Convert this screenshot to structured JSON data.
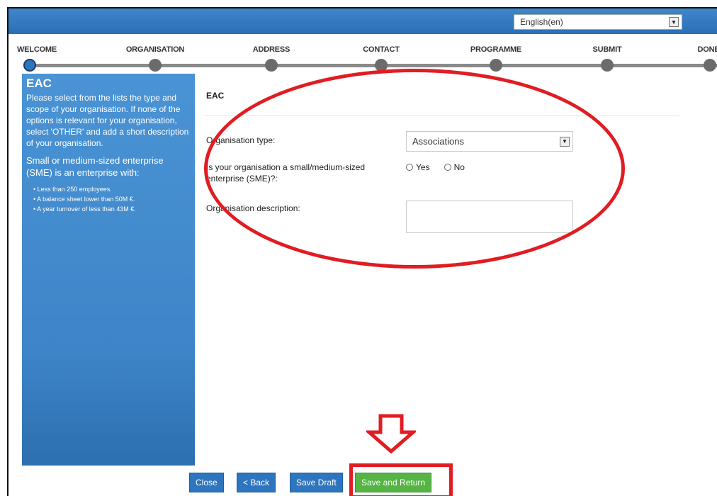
{
  "header": {
    "language_value": "English(en)"
  },
  "stepper": {
    "steps": [
      "WELCOME",
      "ORGANISATION",
      "ADDRESS",
      "CONTACT",
      "PROGRAMME",
      "SUBMIT",
      "DONE"
    ],
    "active_index": 0
  },
  "info": {
    "title": "EAC",
    "paragraph1": "Please select from the lists the type and scope of your organisation. If none of the options is relevant for your organisation, select 'OTHER' and add a short description of your organisation.",
    "paragraph2": "Small or medium-sized enterprise (SME) is an enterprise with:",
    "bullets": [
      "Less than 250 employees.",
      "A balance sheet lower than 50M €.",
      "A year turnover of less than 43M €."
    ]
  },
  "form": {
    "section_title": "EAC",
    "org_type_label": "Organisation type:",
    "org_type_value": "Associations",
    "sme_label": "Is your organisation a small/medium-sized enterprise (SME)?:",
    "sme_yes": "Yes",
    "sme_no": "No",
    "description_label": "Organisation description:"
  },
  "buttons": {
    "close": "Close",
    "back": "< Back",
    "save_draft": "Save Draft",
    "save_return": "Save and Return"
  },
  "colors": {
    "primary": "#2e75c0",
    "success": "#55b443",
    "annotation_red": "#e11c22"
  }
}
